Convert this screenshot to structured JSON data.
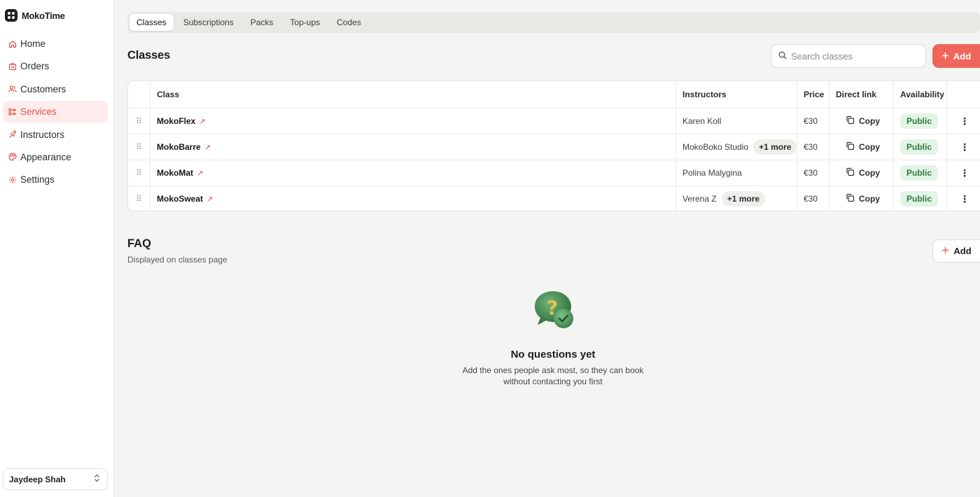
{
  "app": {
    "name": "MokoTime"
  },
  "sidebar": {
    "items": [
      {
        "label": "Home",
        "icon": "home-icon"
      },
      {
        "label": "Orders",
        "icon": "bag-icon"
      },
      {
        "label": "Customers",
        "icon": "users-icon"
      },
      {
        "label": "Services",
        "icon": "grid-list-icon",
        "active": true
      },
      {
        "label": "Instructors",
        "icon": "instructor-icon"
      },
      {
        "label": "Appearance",
        "icon": "palette-icon"
      },
      {
        "label": "Settings",
        "icon": "gear-icon"
      }
    ],
    "user": "Jaydeep Shah"
  },
  "tabs": [
    {
      "label": "Classes",
      "active": true
    },
    {
      "label": "Subscriptions"
    },
    {
      "label": "Packs"
    },
    {
      "label": "Top-ups"
    },
    {
      "label": "Codes"
    }
  ],
  "classes": {
    "title": "Classes",
    "search_placeholder": "Search classes",
    "add_label": "Add",
    "columns": {
      "class": "Class",
      "instructors": "Instructors",
      "price": "Price",
      "direct_link": "Direct link",
      "availability": "Availability"
    },
    "rows": [
      {
        "name": "MokoFlex",
        "instructor": "Karen Koll",
        "more": "",
        "price": "€30",
        "link": "Copy",
        "availability": "Public"
      },
      {
        "name": "MokoBarre",
        "instructor": "MokoBoko Studio",
        "more": "+1 more",
        "price": "€30",
        "link": "Copy",
        "availability": "Public"
      },
      {
        "name": "MokoMat",
        "instructor": "Polina Malygina",
        "more": "",
        "price": "€30",
        "link": "Copy",
        "availability": "Public"
      },
      {
        "name": "MokoSweat",
        "instructor": "Verena Z",
        "more": "+1 more",
        "price": "€30",
        "link": "Copy",
        "availability": "Public"
      }
    ]
  },
  "faq": {
    "title": "FAQ",
    "subtitle": "Displayed on classes page",
    "add_label": "Add",
    "empty_title": "No questions yet",
    "empty_desc": "Add the ones people ask most, so they can book without contacting you first"
  },
  "colors": {
    "accent": "#f0665c",
    "active_bg": "#fdeceb",
    "badge_bg": "#e2f4e5",
    "badge_text": "#2f7a43"
  }
}
